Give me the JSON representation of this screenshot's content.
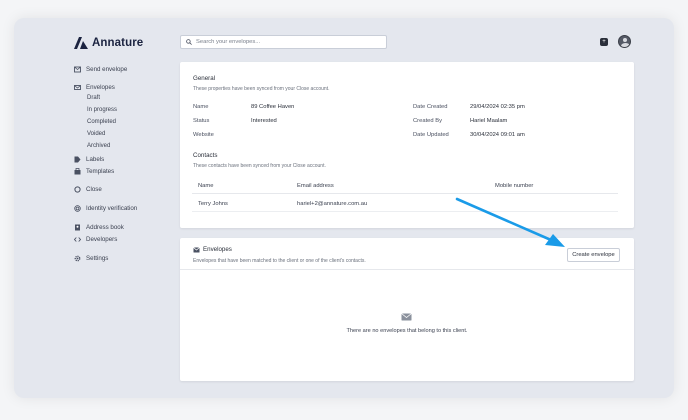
{
  "brand": {
    "name": "Annature"
  },
  "search": {
    "placeholder": "Search your envelopes..."
  },
  "sidebar": {
    "send_envelope": "Send envelope",
    "envelopes": "Envelopes",
    "envelope_sub": [
      "Draft",
      "In progress",
      "Completed",
      "Voided",
      "Archived"
    ],
    "labels": "Labels",
    "templates": "Templates",
    "close": "Close",
    "identity_verification": "Identity verification",
    "address_book": "Address book",
    "developers": "Developers",
    "settings": "Settings"
  },
  "general": {
    "title": "General",
    "subtitle": "These properties have been synced from your Close account.",
    "fields": {
      "name_label": "Name",
      "name_value": "89 Coffee Haven",
      "status_label": "Status",
      "status_value": "Interested",
      "website_label": "Website",
      "date_created_label": "Date Created",
      "date_created_value": "29/04/2024 02:35 pm",
      "created_by_label": "Created By",
      "created_by_value": "Hariel Maalam",
      "date_updated_label": "Date Updated",
      "date_updated_value": "30/04/2024 09:01 am"
    },
    "contacts_title": "Contacts",
    "contacts_subtitle": "These contacts have been synced from your Close account.",
    "columns": [
      "Name",
      "Email address",
      "Mobile number"
    ],
    "rows": [
      {
        "name": "Terry Johns",
        "email": "hariel+2@annature.com.au",
        "mobile": ""
      }
    ]
  },
  "envelopes_card": {
    "title": "Envelopes",
    "subtitle": "Envelopes that have been matched to the client or one of the client's contacts.",
    "create_button": "Create envelope",
    "empty_text": "There are no envelopes that belong to this client."
  },
  "colors": {
    "accent_arrow": "#1a9be8",
    "brand": "#1b2340"
  }
}
